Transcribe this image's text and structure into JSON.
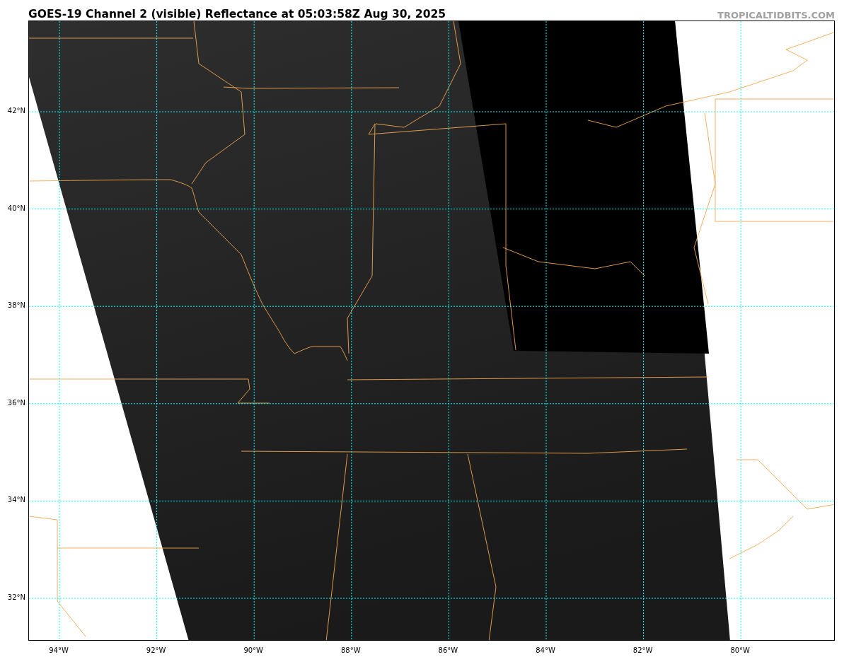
{
  "title": "GOES-19 Channel 2 (visible) Reflectance at 05:03:58Z Aug 30, 2025",
  "credit": "TROPICALTIDBITS.COM",
  "latitude_labels": [
    "42°N",
    "40°N",
    "38°N",
    "36°N",
    "34°N",
    "32°N"
  ],
  "longitude_labels": [
    "94°W",
    "92°W",
    "90°W",
    "88°W",
    "86°W",
    "84°W",
    "82°W",
    "80°W"
  ]
}
